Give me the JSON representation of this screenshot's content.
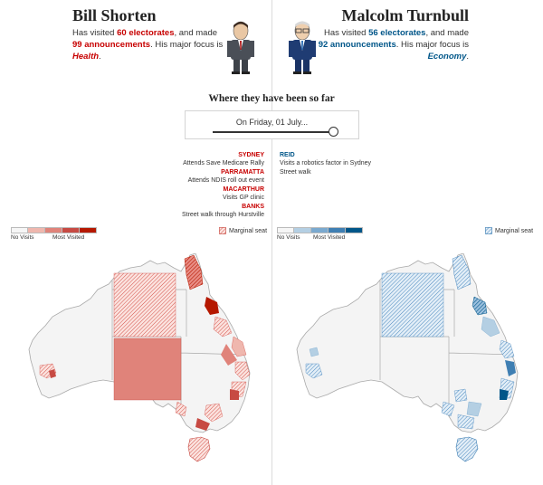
{
  "shorten": {
    "name": "Bill Shorten",
    "t1": "Has visited ",
    "electorates": "60 electorates",
    "t2": ", and made",
    "announcements": "99 announcements",
    "t3": ". His major focus is",
    "focus": "Health",
    "t4": "."
  },
  "turnbull": {
    "name": "Malcolm Turnbull",
    "t1": "Has visited ",
    "electorates": "56 electorates",
    "t2": ", and made",
    "announcements": "92 announcements",
    "t3": ". His major focus is",
    "focus": "Economy",
    "t4": "."
  },
  "so_far_title": "Where they have been so far",
  "slider": {
    "label": "On Friday, 01 July...",
    "position_fraction": 1.0
  },
  "events_shorten": [
    {
      "place": "SYDNEY",
      "items": [
        "Attends Save Medicare Rally"
      ]
    },
    {
      "place": "PARRAMATTA",
      "items": [
        "Attends NDIS roll out event"
      ]
    },
    {
      "place": "MACARTHUR",
      "items": [
        "Visits GP clinic"
      ]
    },
    {
      "place": "BANKS",
      "items": [
        "Street walk through Hurstville"
      ]
    }
  ],
  "events_turnbull": [
    {
      "place": "REID",
      "items": [
        "Visits a robotics factor in Sydney",
        "Street walk"
      ]
    }
  ],
  "legend": {
    "no_visits": "No Visits",
    "most_visited": "Most Visited",
    "marginal": "Marginal seat",
    "red_scale": [
      "#f6f6f6",
      "#efb7ae",
      "#e0837a",
      "#c74a43",
      "#b51800"
    ],
    "blue_scale": [
      "#f6f6f6",
      "#b4cfe3",
      "#7aa9cf",
      "#3f7fb3",
      "#005689"
    ]
  },
  "colors": {
    "red": "#c70000",
    "blue": "#005689",
    "map_fill": "#f4f4f4",
    "map_border": "#b0b0b0"
  }
}
